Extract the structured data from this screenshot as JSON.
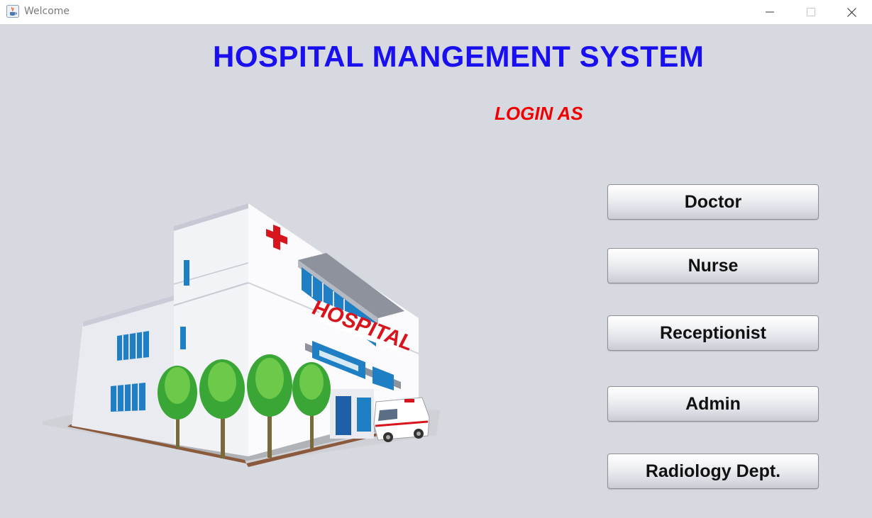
{
  "window": {
    "title": "Welcome",
    "app_icon": "java-cup-icon",
    "controls": [
      "minimize-icon",
      "maximize-icon",
      "close-icon"
    ]
  },
  "header": {
    "title": "HOSPITAL MANGEMENT SYSTEM",
    "subtitle": "LOGIN AS"
  },
  "illustration": {
    "sign_text": "HOSPITAL"
  },
  "roles": [
    {
      "label": "Doctor"
    },
    {
      "label": "Nurse"
    },
    {
      "label": "Receptionist"
    },
    {
      "label": "Admin"
    },
    {
      "label": "Radiology Dept."
    }
  ],
  "colors": {
    "background": "#d6d9e0",
    "title": "#1a0ff0",
    "subtitle": "#f00000"
  }
}
